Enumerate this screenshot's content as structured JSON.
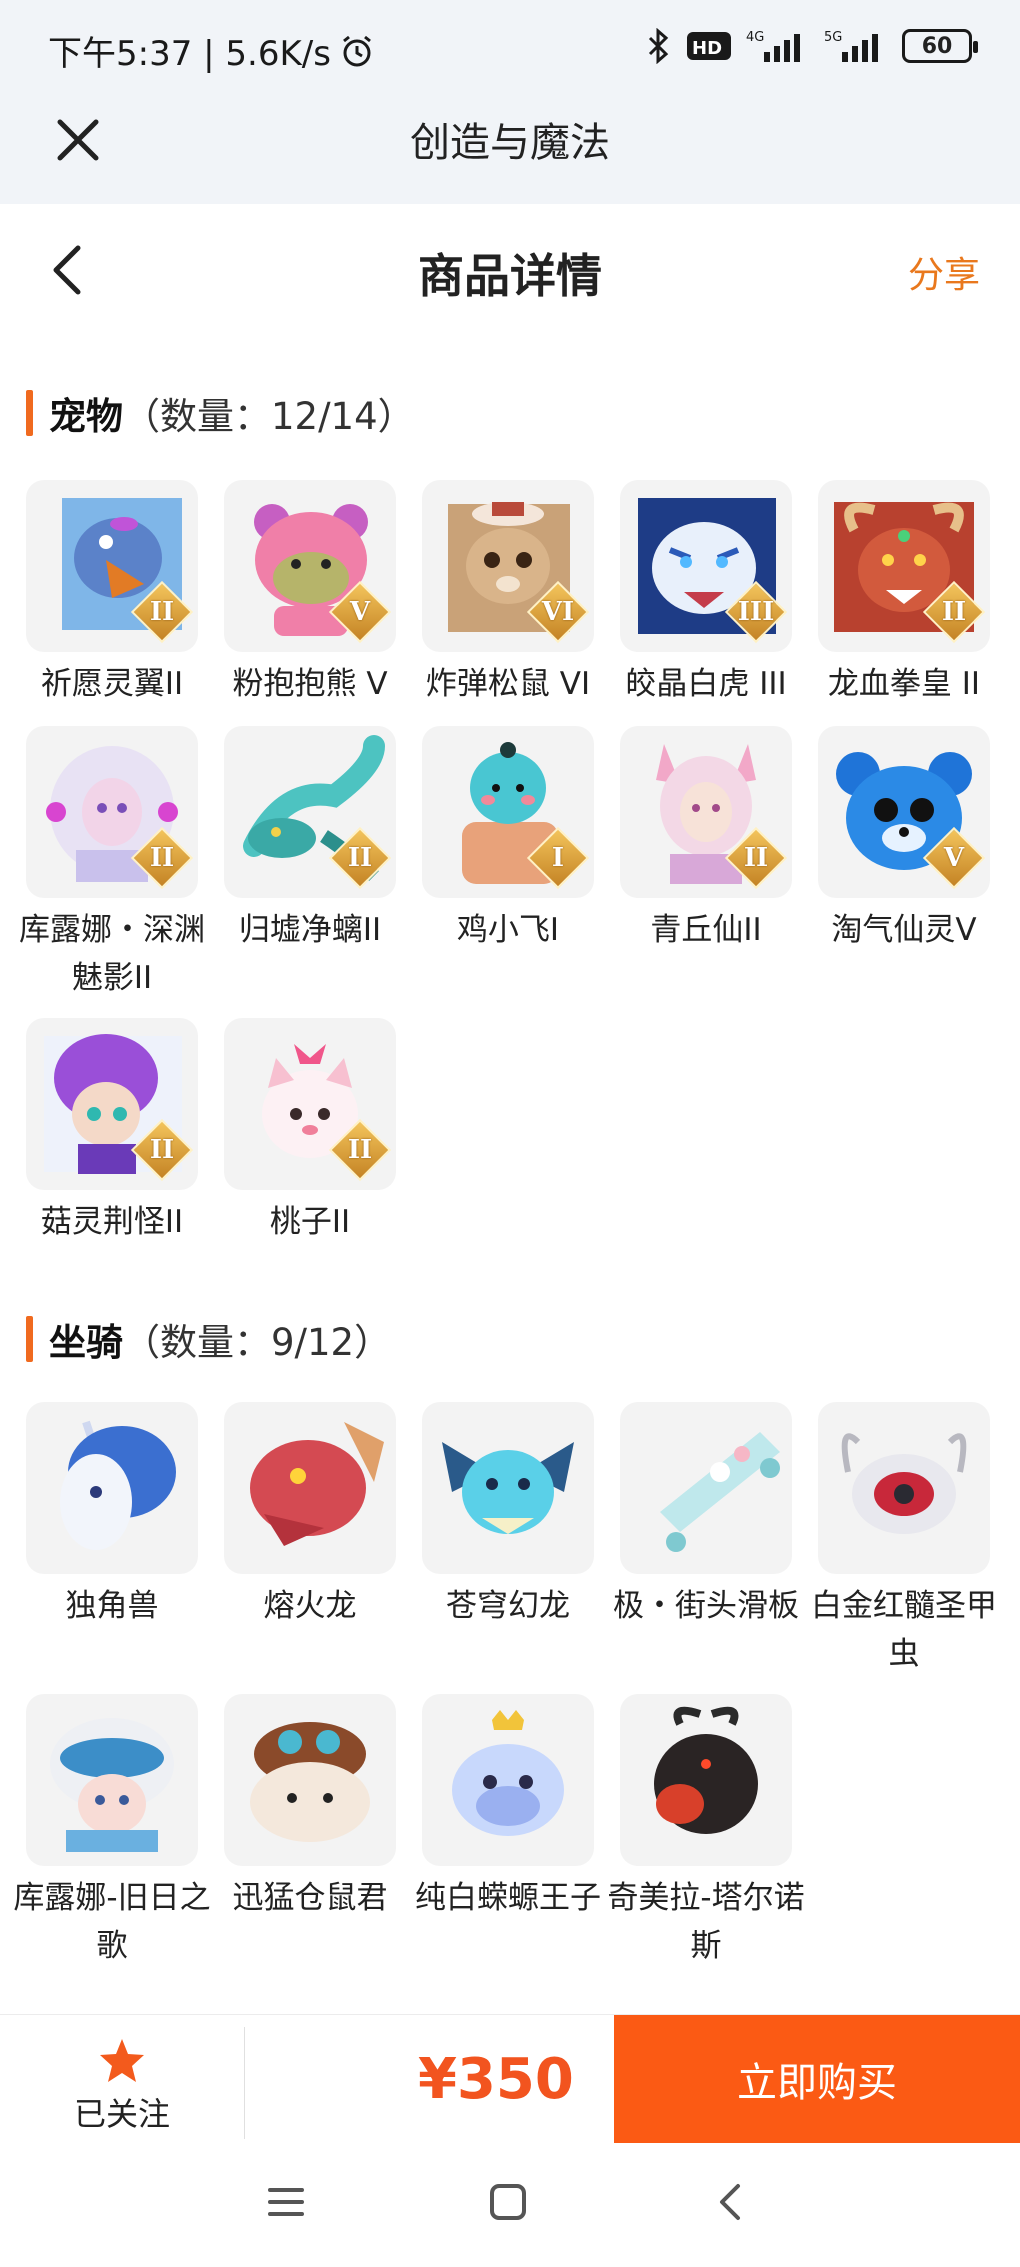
{
  "status_bar": {
    "time_speed": "下午5:37 | 5.6K/s",
    "network_hd": "HD",
    "network_4g": "4G",
    "network_5g": "5G",
    "battery": "60"
  },
  "app_header": {
    "title": "创造与魔法"
  },
  "detail_nav": {
    "title": "商品详情",
    "share_label": "分享"
  },
  "pets": {
    "name": "宠物",
    "count": "（数量：12/14）",
    "items": [
      {
        "name": "祈愿灵翼II",
        "badge": "II"
      },
      {
        "name": "粉抱抱熊 V",
        "badge": "V"
      },
      {
        "name": "炸弹松鼠 VI",
        "badge": "VI"
      },
      {
        "name": "皎晶白虎 III",
        "badge": "III"
      },
      {
        "name": "龙血拳皇 II",
        "badge": "II"
      },
      {
        "name": "库露娜・深渊魅影II",
        "badge": "II"
      },
      {
        "name": "归墟净螭II",
        "badge": "II"
      },
      {
        "name": "鸡小飞I",
        "badge": "I"
      },
      {
        "name": "青丘仙II",
        "badge": "II"
      },
      {
        "name": "淘气仙灵V",
        "badge": "V"
      },
      {
        "name": "菇灵荆怪II",
        "badge": "II"
      },
      {
        "name": "桃子II",
        "badge": "II"
      }
    ]
  },
  "mounts": {
    "name": "坐骑",
    "count": "（数量：9/12）",
    "items": [
      {
        "name": "独角兽"
      },
      {
        "name": "熔火龙"
      },
      {
        "name": "苍穹幻龙"
      },
      {
        "name": "极・街头滑板"
      },
      {
        "name": "白金红髓圣甲虫"
      },
      {
        "name": "库露娜-旧日之歌"
      },
      {
        "name": "迅猛仓鼠君"
      },
      {
        "name": "纯白蝾螈王子"
      },
      {
        "name": "奇美拉-塔尔诺斯"
      }
    ]
  },
  "bottom_bar": {
    "follow_label": "已关注",
    "price": "¥350",
    "buy_label": "立即购买"
  },
  "colors": {
    "accent": "#fb5a14",
    "price": "#f2541f",
    "share": "#e9781d",
    "star": "#f35a1c"
  }
}
